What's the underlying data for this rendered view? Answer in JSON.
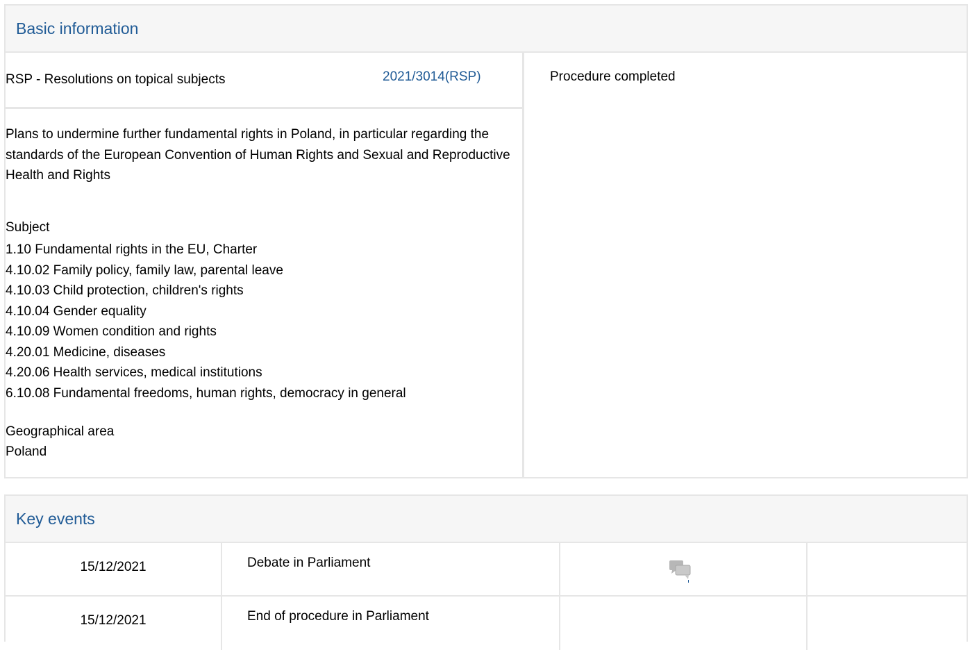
{
  "basic_information": {
    "header": "Basic information",
    "procedure_type": "RSP - Resolutions on topical subjects",
    "procedure_reference": "2021/3014(RSP)",
    "status": "Procedure completed",
    "title": "Plans to undermine further fundamental rights in Poland, in particular regarding the standards of the European Convention of Human Rights and Sexual and Reproductive Health and Rights",
    "subject_label": "Subject",
    "subjects": [
      "1.10 Fundamental rights in the EU, Charter",
      "4.10.02 Family policy, family law, parental leave",
      "4.10.03 Child protection, children's rights",
      "4.10.04 Gender equality",
      "4.10.09 Women condition and rights",
      "4.20.01 Medicine, diseases",
      "4.20.06 Health services, medical institutions",
      "6.10.08 Fundamental freedoms, human rights, democracy in general"
    ],
    "geo_label": "Geographical area",
    "geo_value": "Poland"
  },
  "key_events": {
    "header": "Key events",
    "rows": [
      {
        "date": "15/12/2021",
        "event": "Debate in Parliament",
        "icon": "debate-icon"
      },
      {
        "date": "15/12/2021",
        "event": "End of procedure in Parliament",
        "icon": ""
      }
    ]
  }
}
